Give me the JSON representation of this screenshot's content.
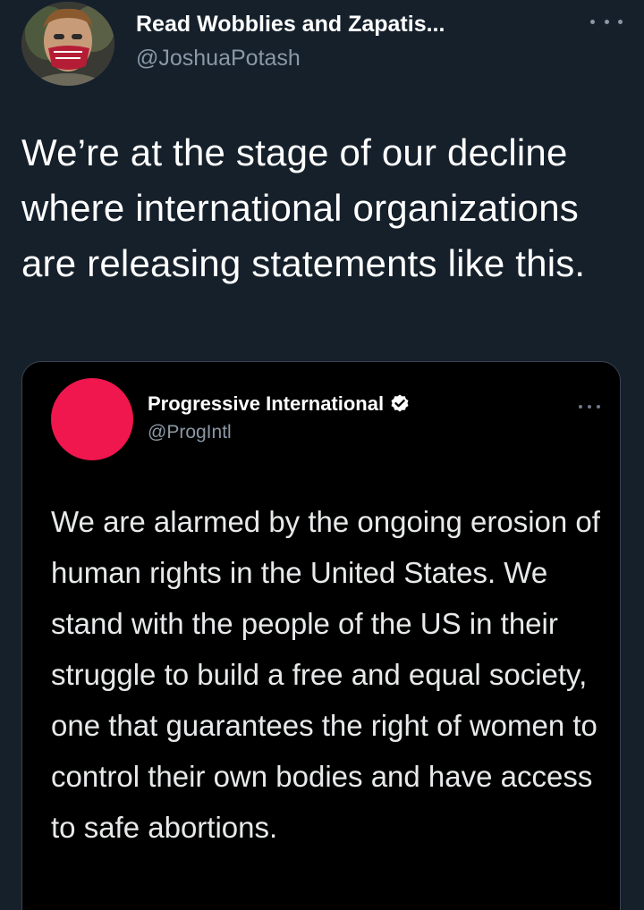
{
  "tweet": {
    "author_name": "Read Wobblies and Zapatis...",
    "author_handle": "@JoshuaPotash",
    "text": "We’re at the stage of our decline where international organizations are releasing statements like this.",
    "more_icon": "more-horizontal-icon"
  },
  "quoted_tweet": {
    "author_name": "Progressive International",
    "author_handle": "@ProgIntl",
    "verified_icon": "verified-badge-icon",
    "avatar_color": "#f0164e",
    "text": "We are alarmed by the ongoing erosion of human rights in the United States. We stand with the people of the US in their struggle to build a free and equal society, one that guarantees the right of women to control their own bodies and have access to safe abortions."
  },
  "colors": {
    "background": "#15202b",
    "card_background": "#000000",
    "secondary_text": "#8b98a5"
  }
}
